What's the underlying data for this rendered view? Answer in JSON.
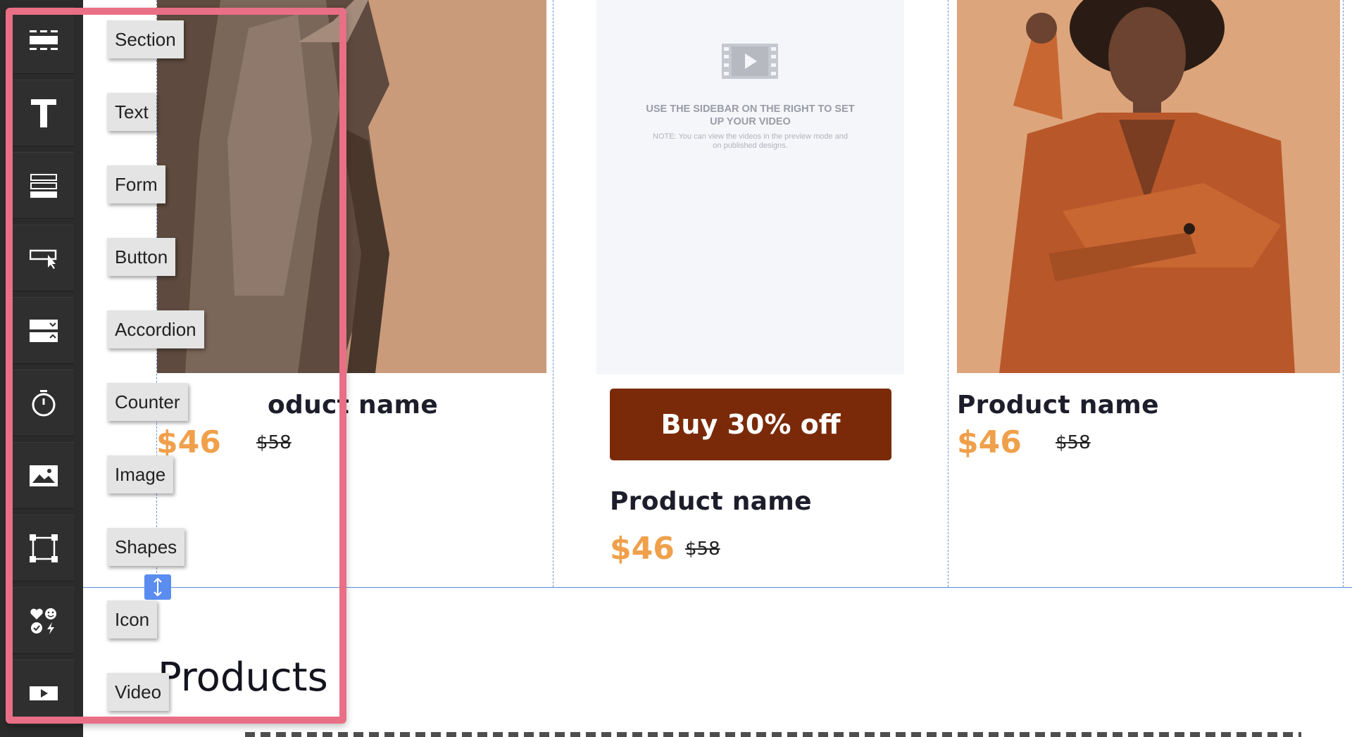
{
  "toolbar": {
    "items": [
      {
        "icon": "section-icon",
        "tooltip": "Section"
      },
      {
        "icon": "text-icon",
        "tooltip": "Text"
      },
      {
        "icon": "form-icon",
        "tooltip": "Form"
      },
      {
        "icon": "button-icon",
        "tooltip": "Button"
      },
      {
        "icon": "accordion-icon",
        "tooltip": "Accordion"
      },
      {
        "icon": "counter-icon",
        "tooltip": "Counter"
      },
      {
        "icon": "image-icon",
        "tooltip": "Image"
      },
      {
        "icon": "shapes-icon",
        "tooltip": "Shapes"
      },
      {
        "icon": "icon-icon",
        "tooltip": "Icon"
      },
      {
        "icon": "video-icon",
        "tooltip": "Video"
      }
    ]
  },
  "video_placeholder": {
    "title": "USE THE SIDEBAR ON THE RIGHT TO SET UP YOUR VIDEO",
    "note": "NOTE: You can view the videos in the preview mode and on published designs."
  },
  "products": [
    {
      "name": "Product name",
      "visible_name": "oduct name",
      "price": "$46",
      "old_price": "$58"
    },
    {
      "name": "Product name",
      "price": "$46",
      "old_price": "$58",
      "button": "Buy 30% off"
    },
    {
      "name": "Product name",
      "price": "$46",
      "old_price": "$58"
    }
  ],
  "section_heading": "Products",
  "colors": {
    "toolbar_bg": "#2b2b2b",
    "highlight": "#e96f86",
    "price": "#f0a04b",
    "buy_button": "#7a2a08",
    "guide": "#5f8de0"
  }
}
